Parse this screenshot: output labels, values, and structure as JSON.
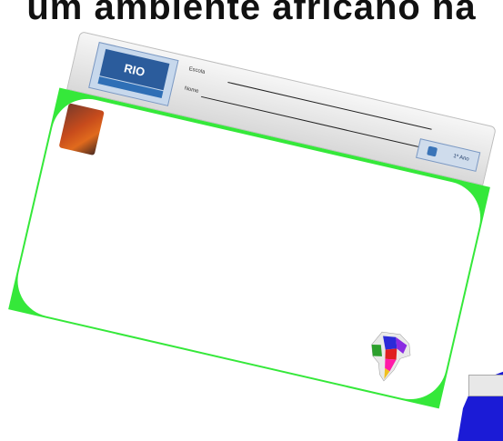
{
  "headline": "um ambiente africano na",
  "header": {
    "logo_text": "RIO",
    "school_label": "Escola",
    "name_label": "Nome",
    "badge_text": "1º Ano"
  },
  "body": {
    "text": ""
  }
}
